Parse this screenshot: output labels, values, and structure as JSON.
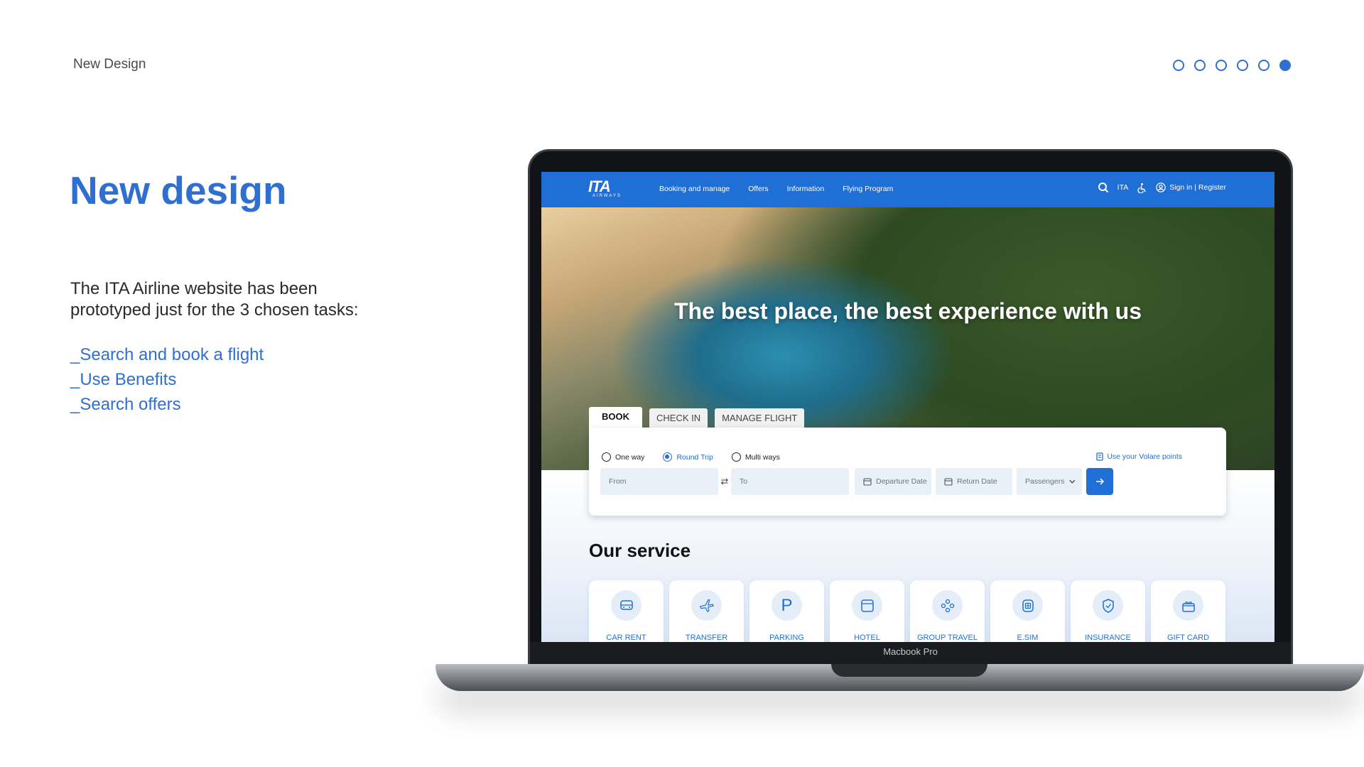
{
  "slide": {
    "label": "New Design",
    "pager_count": 6,
    "pager_active_index": 5
  },
  "headline": "New design",
  "intro": "The ITA Airline website has been prototyped just for the 3 chosen tasks:",
  "tasks": [
    "_Search and book a flight",
    "_Use Benefits",
    "_Search offers"
  ],
  "device_label": "Macbook Pro",
  "site": {
    "logo_main": "ITA",
    "logo_sub": "AIRWAYS",
    "menu": [
      "Booking and manage",
      "Offers",
      "Information",
      "Flying Program"
    ],
    "lang": "ITA",
    "signin": "Sign in | Register",
    "hero_title": "The best place, the best experience with us",
    "tabs": [
      "BOOK",
      "CHECK IN",
      "MANAGE FLIGHT"
    ],
    "trip_types": [
      "One way",
      "Round Trip",
      "Multi ways"
    ],
    "selected_trip": "Round Trip",
    "volare_link": "Use your Volare points",
    "fields": {
      "from": "From",
      "to": "To",
      "departure": "Departure Date",
      "return": "Return Date",
      "passengers": "Passengers"
    },
    "services_title": "Our service",
    "services": [
      "CAR RENT",
      "TRANSFER",
      "PARKING",
      "HOTEL",
      "GROUP TRAVEL",
      "E.SIM",
      "INSURANCE",
      "GIFT CARD"
    ],
    "colors": {
      "brand_blue": "#1f6fd6",
      "accent_blue": "#2f6fd1"
    }
  }
}
